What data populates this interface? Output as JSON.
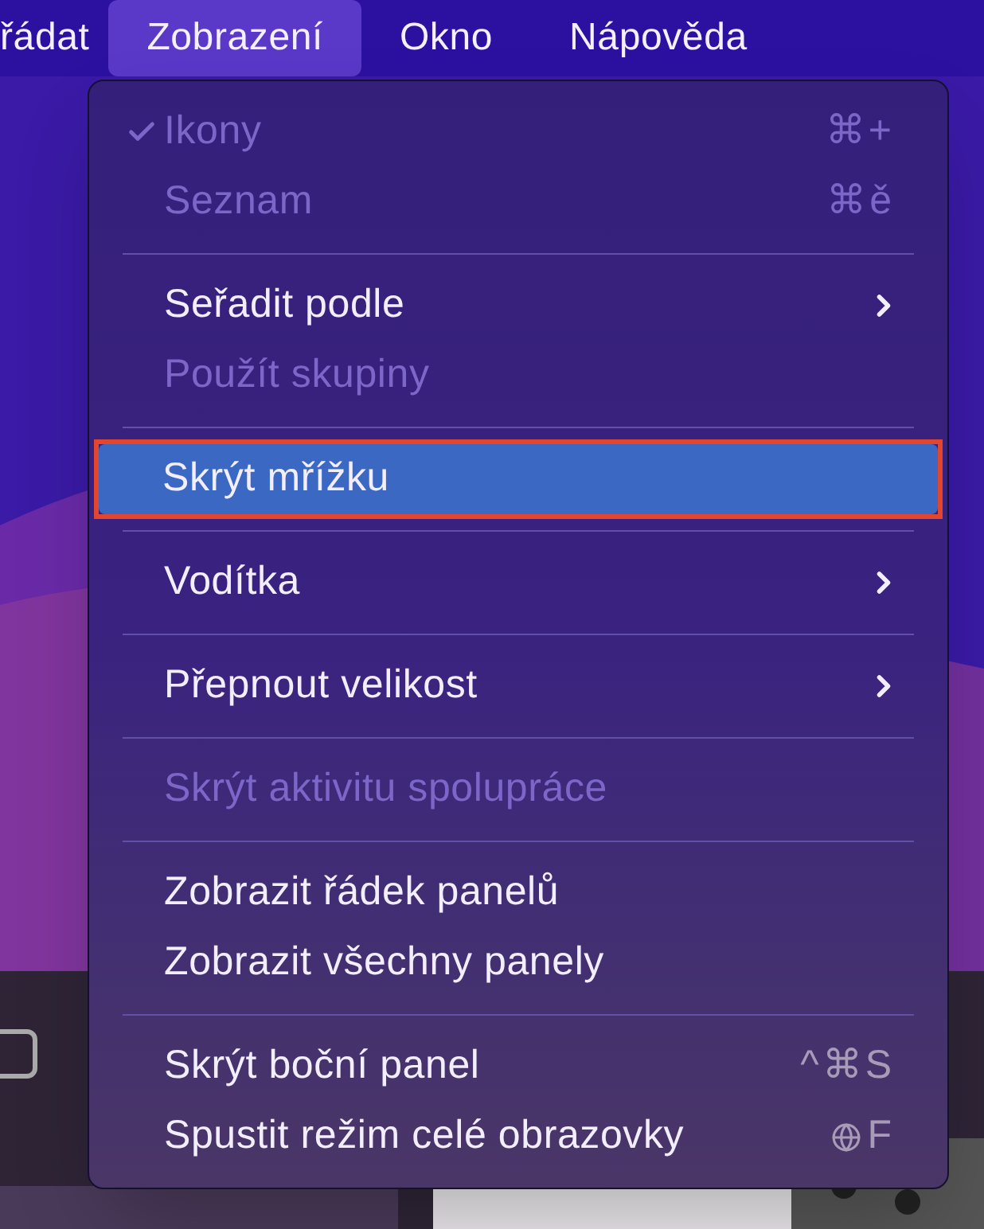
{
  "menu_bar": [
    {
      "label": "řádat",
      "selected": false
    },
    {
      "label": "Zobrazení",
      "selected": true
    },
    {
      "label": "Okno",
      "selected": false
    },
    {
      "label": "Nápověda",
      "selected": false
    }
  ],
  "menu": {
    "items": [
      {
        "kind": "item",
        "label": "Ikony",
        "checked": true,
        "disabled": true,
        "selected": false,
        "submenu": false,
        "outlined": false,
        "shortcut": "⌘+"
      },
      {
        "kind": "item",
        "label": "Seznam",
        "checked": false,
        "disabled": true,
        "selected": false,
        "submenu": false,
        "outlined": false,
        "shortcut": "⌘ě"
      },
      {
        "kind": "separator"
      },
      {
        "kind": "item",
        "label": "Seřadit podle",
        "checked": false,
        "disabled": false,
        "selected": false,
        "submenu": true,
        "outlined": false
      },
      {
        "kind": "item",
        "label": "Použít skupiny",
        "checked": false,
        "disabled": true,
        "selected": false,
        "submenu": false,
        "outlined": false
      },
      {
        "kind": "separator"
      },
      {
        "kind": "item",
        "label": "Skrýt mřížku",
        "checked": false,
        "disabled": false,
        "selected": true,
        "submenu": false,
        "outlined": true
      },
      {
        "kind": "separator"
      },
      {
        "kind": "item",
        "label": "Vodítka",
        "checked": false,
        "disabled": false,
        "selected": false,
        "submenu": true,
        "outlined": false
      },
      {
        "kind": "separator"
      },
      {
        "kind": "item",
        "label": "Přepnout velikost",
        "checked": false,
        "disabled": false,
        "selected": false,
        "submenu": true,
        "outlined": false
      },
      {
        "kind": "separator"
      },
      {
        "kind": "item",
        "label": "Skrýt aktivitu spolupráce",
        "checked": false,
        "disabled": true,
        "selected": false,
        "submenu": false,
        "outlined": false
      },
      {
        "kind": "separator"
      },
      {
        "kind": "item",
        "label": "Zobrazit řádek panelů",
        "checked": false,
        "disabled": false,
        "selected": false,
        "submenu": false,
        "outlined": false
      },
      {
        "kind": "item",
        "label": "Zobrazit všechny panely",
        "checked": false,
        "disabled": false,
        "selected": false,
        "submenu": false,
        "outlined": false
      },
      {
        "kind": "separator"
      },
      {
        "kind": "item",
        "label": "Skrýt boční panel",
        "checked": false,
        "disabled": false,
        "selected": false,
        "submenu": false,
        "outlined": false,
        "shortcut": "^⌘S"
      },
      {
        "kind": "globe_item",
        "label": "Spustit režim celé obrazovky",
        "checked": false,
        "disabled": false,
        "selected": false,
        "submenu": false,
        "outlined": false,
        "shortcut": "F"
      }
    ]
  }
}
